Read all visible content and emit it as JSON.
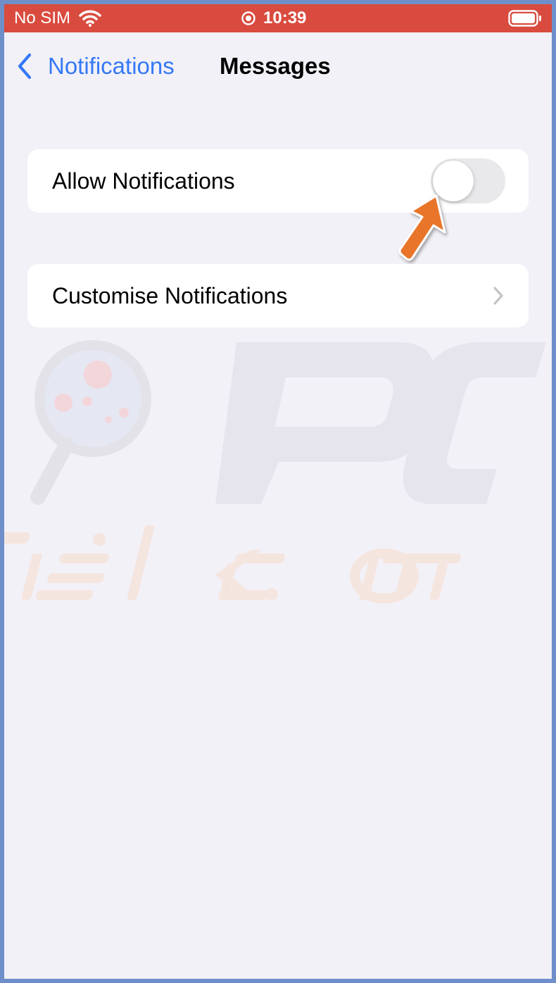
{
  "status_bar": {
    "carrier": "No SIM",
    "time": "10:39",
    "background_color": "#d94b3e",
    "icons": [
      "wifi-icon",
      "lock-rotation-icon",
      "battery-icon"
    ]
  },
  "nav": {
    "back_label": "Notifications",
    "title": "Messages",
    "accent_color": "#3478f6",
    "back_icon": "chevron-left-icon"
  },
  "settings": {
    "allow_notifications": {
      "label": "Allow Notifications",
      "toggle_on": false
    },
    "customise_notifications": {
      "label": "Customise Notifications",
      "icon": "chevron-right-icon"
    }
  },
  "annotation": {
    "icon": "pointer-arrow-icon",
    "color": "#e8742a"
  },
  "watermark": {
    "logo": "pcrisk-magnifier-logo",
    "text_line1": "PC",
    "text_line2": "risk.com"
  }
}
